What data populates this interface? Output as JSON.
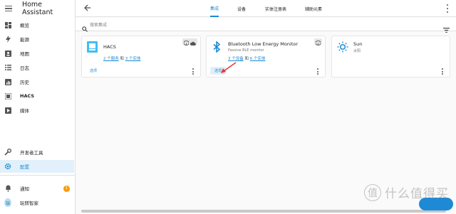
{
  "app_title": "Home Assistant",
  "sidebar": {
    "items": [
      {
        "label": "概览",
        "icon": "dashboard-icon"
      },
      {
        "label": "能源",
        "icon": "lightning-icon"
      },
      {
        "label": "地图",
        "icon": "map-icon"
      },
      {
        "label": "日志",
        "icon": "list-icon"
      },
      {
        "label": "历史",
        "icon": "chart-icon"
      },
      {
        "label": "HACS",
        "icon": "hacs-icon"
      },
      {
        "label": "媒体",
        "icon": "media-icon"
      }
    ],
    "dev_tools": "开发者工具",
    "settings": "配置",
    "notifications": "通知",
    "notifications_count": "1",
    "user_name": "玩转智家",
    "user_initial": "玩"
  },
  "topbar": {
    "tabs": [
      "集成",
      "设备",
      "实体注册表",
      "辅助元素"
    ],
    "active_tab": 0
  },
  "search": {
    "placeholder": "搜索集成"
  },
  "cards": [
    {
      "title": "HACS",
      "subtitle": "",
      "link1": "2 个服务",
      "conj": "和",
      "link2": "3 个实体",
      "button": "选项",
      "badges": [
        "cube-icon",
        "cloud-icon"
      ]
    },
    {
      "title": "Bluetooth Low Energy Monitor",
      "subtitle": "Passive BLE monitor",
      "link1": "3 个设备",
      "conj": "和",
      "link2": "6 个实体",
      "button": "选项",
      "badges": [
        "cube-icon"
      ]
    },
    {
      "title": "Sun",
      "subtitle": "太阳"
    }
  ],
  "colors": {
    "accent": "#1e8ad6",
    "annotation": "#e53935",
    "badge": "#ff9800"
  },
  "watermark": "什么值得买",
  "watermark_mark": "值"
}
